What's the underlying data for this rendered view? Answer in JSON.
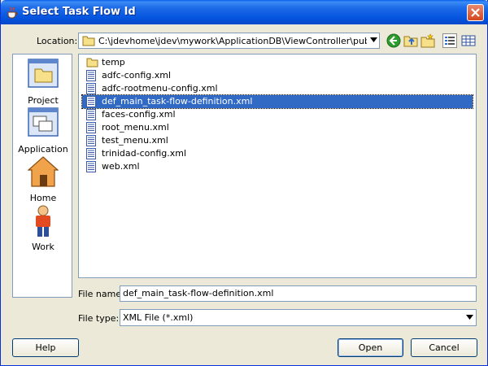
{
  "window": {
    "title": "Select Task Flow Id"
  },
  "location": {
    "label": "Location:",
    "value": "C:\\jdevhome\\jdev\\mywork\\ApplicationDB\\ViewController\\public_ht..."
  },
  "toolbar": {
    "icons": [
      "back-icon",
      "up-folder-icon",
      "new-folder-icon",
      "list-view-icon",
      "details-view-icon"
    ]
  },
  "places": [
    {
      "label": "Project",
      "icon": "project-icon"
    },
    {
      "label": "Application",
      "icon": "application-icon"
    },
    {
      "label": "Home",
      "icon": "home-icon"
    },
    {
      "label": "Work",
      "icon": "work-icon"
    }
  ],
  "files": [
    {
      "name": "temp",
      "type": "folder",
      "selected": false
    },
    {
      "name": "adfc-config.xml",
      "type": "file",
      "selected": false
    },
    {
      "name": "adfc-rootmenu-config.xml",
      "type": "file",
      "selected": false
    },
    {
      "name": "def_main_task-flow-definition.xml",
      "type": "file",
      "selected": true
    },
    {
      "name": "faces-config.xml",
      "type": "file",
      "selected": false
    },
    {
      "name": "root_menu.xml",
      "type": "file",
      "selected": false
    },
    {
      "name": "test_menu.xml",
      "type": "file",
      "selected": false
    },
    {
      "name": "trinidad-config.xml",
      "type": "file",
      "selected": false
    },
    {
      "name": "web.xml",
      "type": "file",
      "selected": false
    }
  ],
  "file_name": {
    "label": "File name:",
    "value": "def_main_task-flow-definition.xml"
  },
  "file_type": {
    "label": "File type:",
    "value": "XML File (*.xml)"
  },
  "buttons": {
    "help": "Help",
    "open": "Open",
    "cancel": "Cancel"
  },
  "colors": {
    "selection": "#316ac5",
    "titlebar": "#0656e0",
    "close": "#d3461f"
  }
}
